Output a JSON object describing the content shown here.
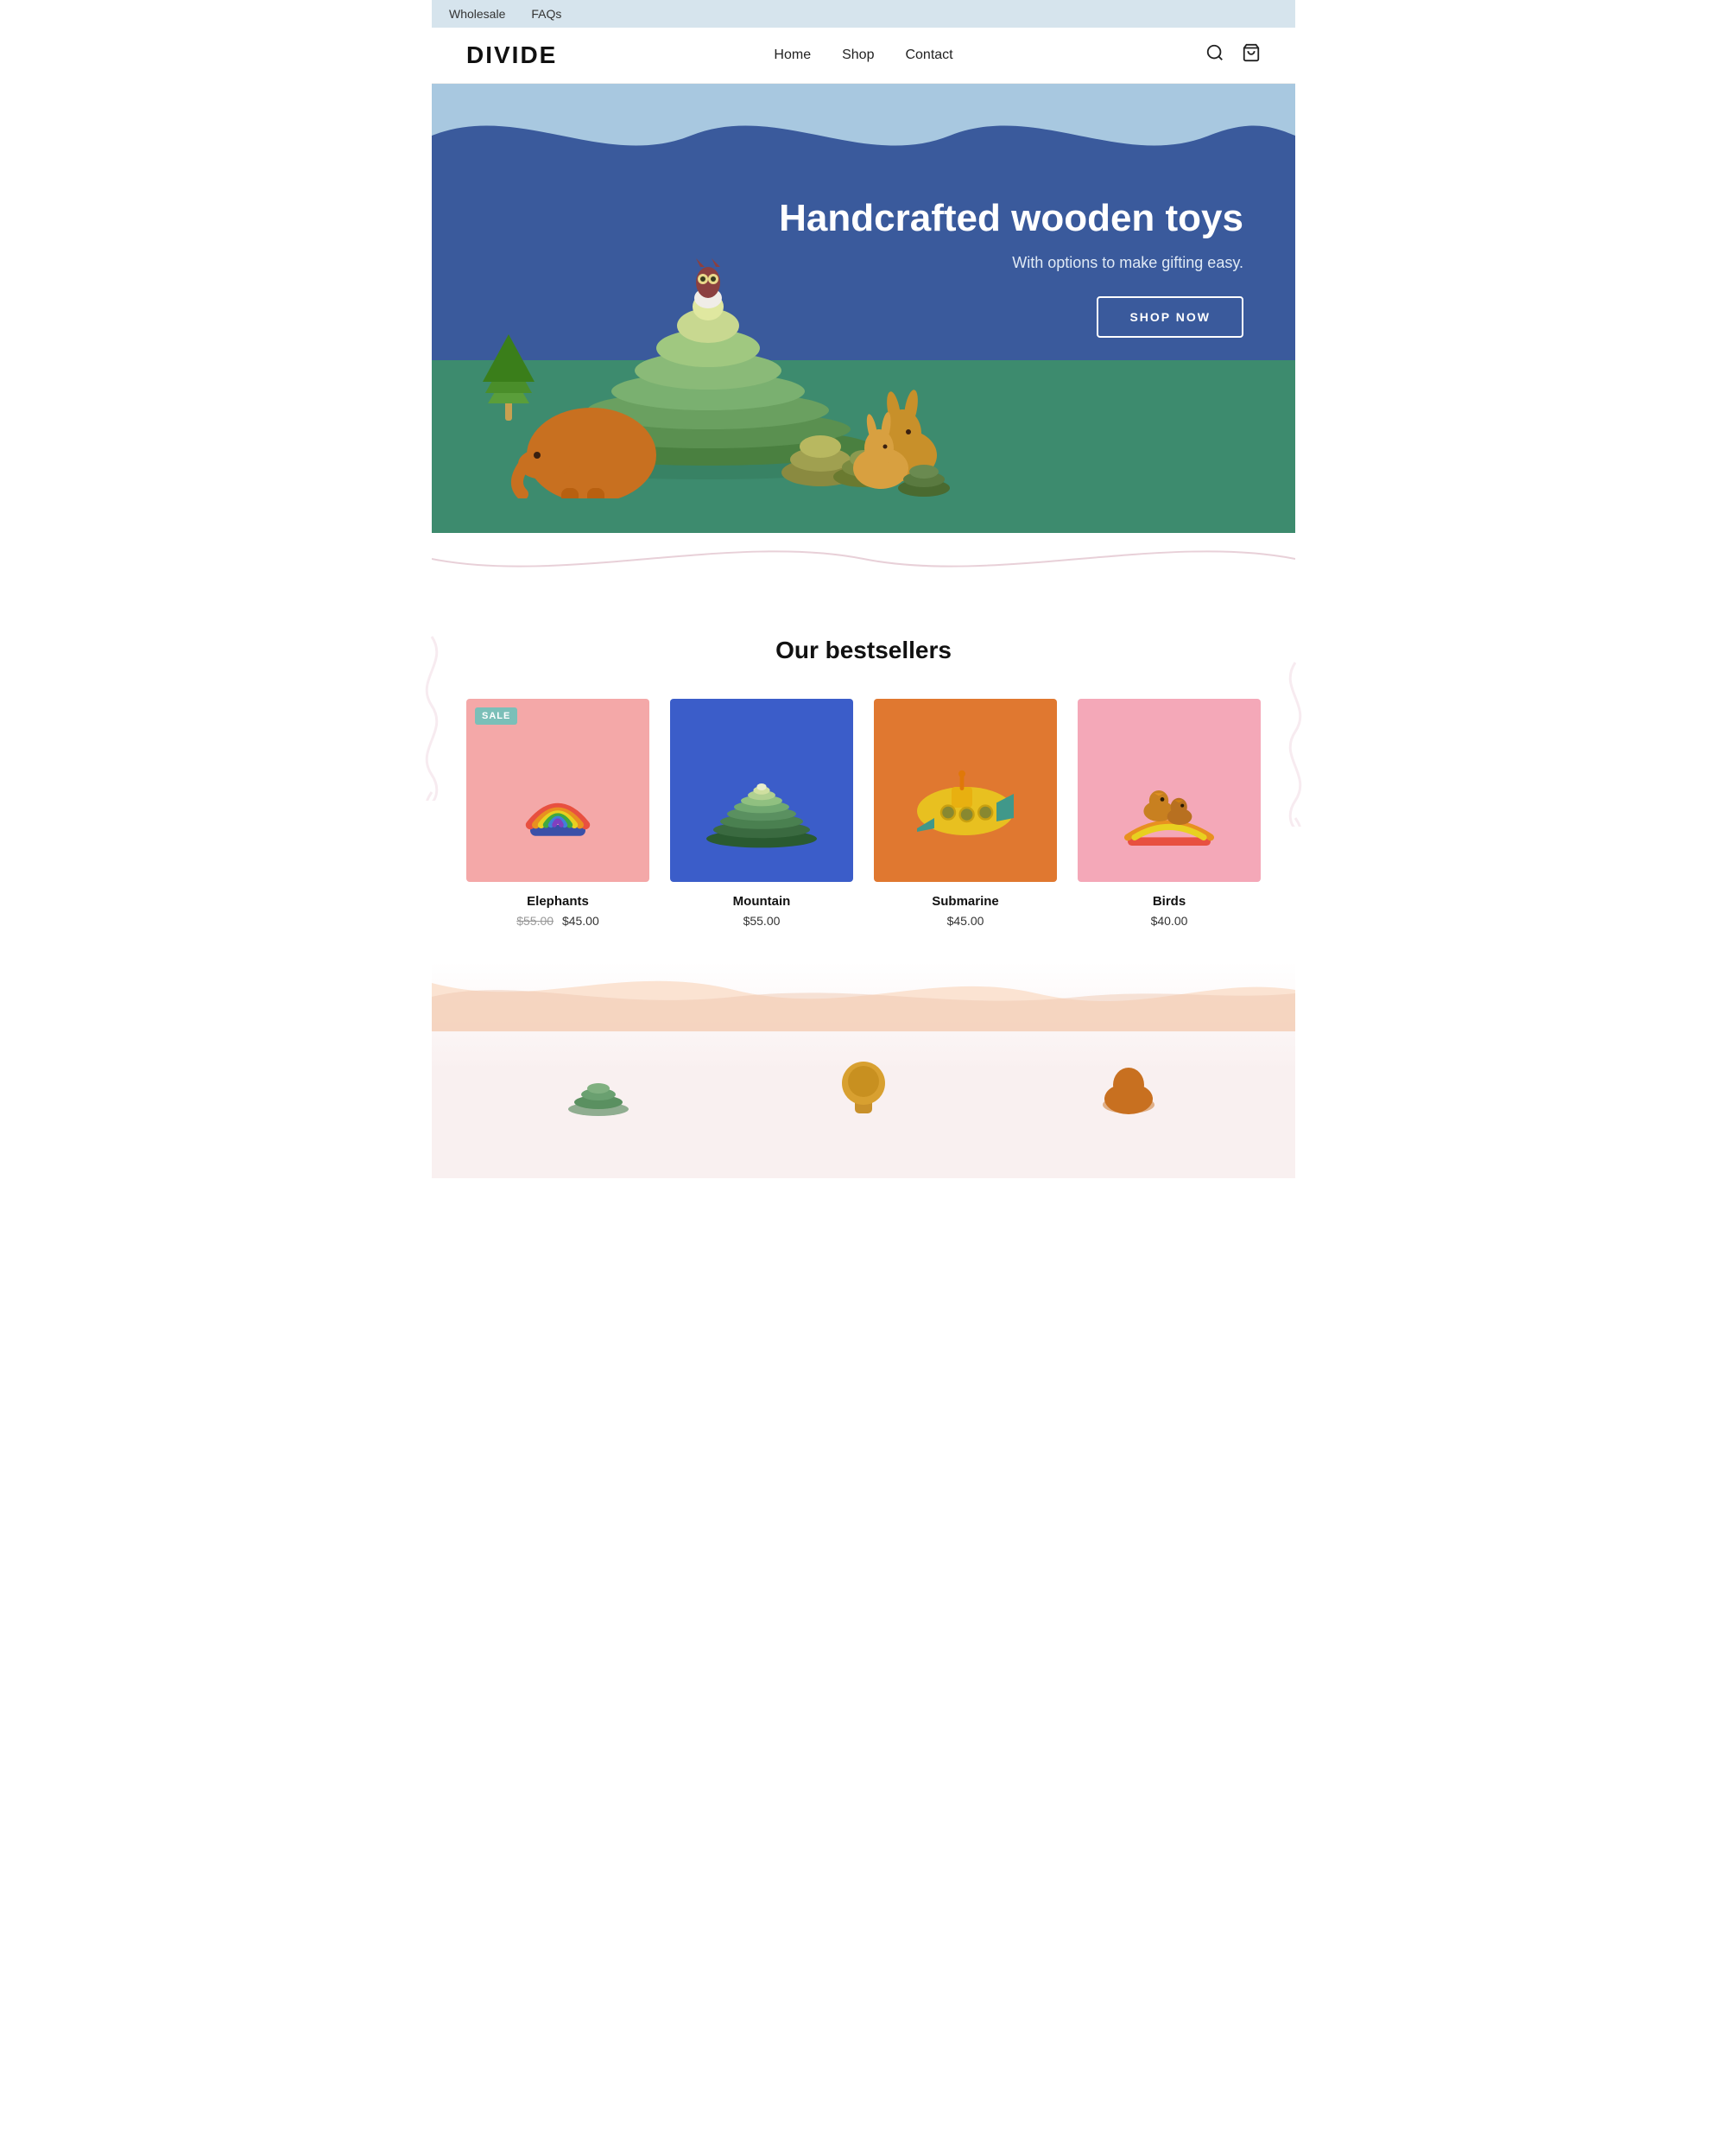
{
  "topbar": {
    "links": [
      "Wholesale",
      "FAQs"
    ]
  },
  "header": {
    "logo": "DIVIDE",
    "nav": [
      "Home",
      "Shop",
      "Contact"
    ]
  },
  "hero": {
    "title": "Handcrafted wooden toys",
    "subtitle": "With options to make gifting easy.",
    "cta": "SHOP NOW"
  },
  "bestsellers": {
    "heading": "Our bestsellers",
    "products": [
      {
        "name": "Elephants",
        "price_original": "$55.00",
        "price_sale": "$45.00",
        "on_sale": true,
        "bg": "bg-pink",
        "color": "#f4a8a8"
      },
      {
        "name": "Mountain",
        "price": "$55.00",
        "on_sale": false,
        "bg": "bg-blue",
        "color": "#3b5dc9"
      },
      {
        "name": "Submarine",
        "price": "$45.00",
        "on_sale": false,
        "bg": "bg-orange",
        "color": "#e07830"
      },
      {
        "name": "Birds",
        "price": "$40.00",
        "on_sale": false,
        "bg": "bg-pink2",
        "color": "#f4a8b8"
      }
    ]
  },
  "labels": {
    "sale": "SALE"
  }
}
